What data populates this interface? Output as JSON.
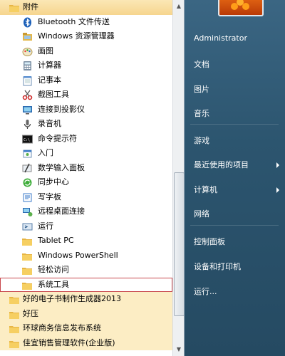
{
  "programs": {
    "accessories": "附件",
    "items": [
      {
        "label": "Bluetooth 文件传送",
        "icon": "bluetooth-icon"
      },
      {
        "label": "Windows 资源管理器",
        "icon": "explorer-icon"
      },
      {
        "label": "画图",
        "icon": "paint-icon"
      },
      {
        "label": "计算器",
        "icon": "calculator-icon"
      },
      {
        "label": "记事本",
        "icon": "notepad-icon"
      },
      {
        "label": "截图工具",
        "icon": "snipping-tool-icon"
      },
      {
        "label": "连接到投影仪",
        "icon": "projector-icon"
      },
      {
        "label": "录音机",
        "icon": "microphone-icon"
      },
      {
        "label": "命令提示符",
        "icon": "command-prompt-icon"
      },
      {
        "label": "入门",
        "icon": "getting-started-icon"
      },
      {
        "label": "数学输入面板",
        "icon": "math-input-icon"
      },
      {
        "label": "同步中心",
        "icon": "sync-center-icon"
      },
      {
        "label": "写字板",
        "icon": "wordpad-icon"
      },
      {
        "label": "远程桌面连接",
        "icon": "remote-desktop-icon"
      },
      {
        "label": "运行",
        "icon": "run-icon"
      }
    ],
    "subfolders": [
      "Tablet PC",
      "Windows PowerShell",
      "轻松访问",
      "系统工具"
    ],
    "top_folders": [
      "好的电子书制作生成器2013",
      "好压",
      "环球商务信息发布系统",
      "佳宜销售管理软件(企业版)"
    ]
  },
  "right_pane": {
    "user": "Administrator",
    "documents": "文档",
    "pictures": "图片",
    "music": "音乐",
    "games": "游戏",
    "recent_items": "最近使用的项目",
    "computer": "计算机",
    "network": "网络",
    "control_panel": "控制面板",
    "devices_printers": "设备和打印机",
    "run": "运行..."
  },
  "colors": {
    "folder_highlight": "#fcedc4",
    "selection_border": "#c8474c",
    "right_pane": "#2c556f"
  }
}
